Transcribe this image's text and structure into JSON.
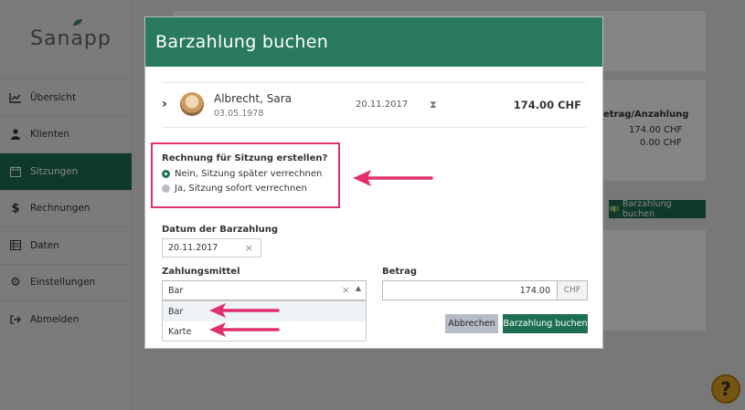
{
  "app": {
    "logo": "Sanapp",
    "nav": [
      {
        "label": "Übersicht",
        "icon": "chart-line-icon",
        "active": false
      },
      {
        "label": "Klienten",
        "icon": "user-icon",
        "active": false
      },
      {
        "label": "Sitzungen",
        "icon": "calendar-icon",
        "active": true
      },
      {
        "label": "Rechnungen",
        "icon": "dollar-icon",
        "active": false
      },
      {
        "label": "Daten",
        "icon": "table-icon",
        "active": false
      },
      {
        "label": "Einstellungen",
        "icon": "gear-icon",
        "active": false
      },
      {
        "label": "Abmelden",
        "icon": "logout-icon",
        "active": false
      }
    ],
    "background": {
      "column_header": "etrag/Anzahlung",
      "amount_1": "174.00 CHF",
      "amount_2": "0.00 CHF",
      "button": "Barzahlung buchen"
    },
    "help": "?"
  },
  "modal": {
    "title": "Barzahlung buchen",
    "patient": {
      "name": "Albrecht, Sara",
      "dob": "03.05.1978",
      "date": "20.11.2017",
      "amount": "174.00 CHF"
    },
    "invoice": {
      "title": "Rechnung für Sitzung erstellen?",
      "options": [
        {
          "label": "Nein, Sitzung später verrechnen",
          "selected": true
        },
        {
          "label": "Ja, Sitzung sofort verrechnen",
          "selected": false
        }
      ]
    },
    "date_label": "Datum der Barzahlung",
    "date_value": "20.11.2017",
    "payment_label": "Zahlungsmittel",
    "payment_value": "Bar",
    "payment_options": [
      "Bar",
      "Karte"
    ],
    "amount_label": "Betrag",
    "amount_value": "174.00",
    "amount_unit": "CHF",
    "cancel_label": "Abbrechen",
    "submit_label": "Barzahlung buchen"
  },
  "colors": {
    "brand": "#2a7a5e",
    "annotation": "#e0306e"
  }
}
